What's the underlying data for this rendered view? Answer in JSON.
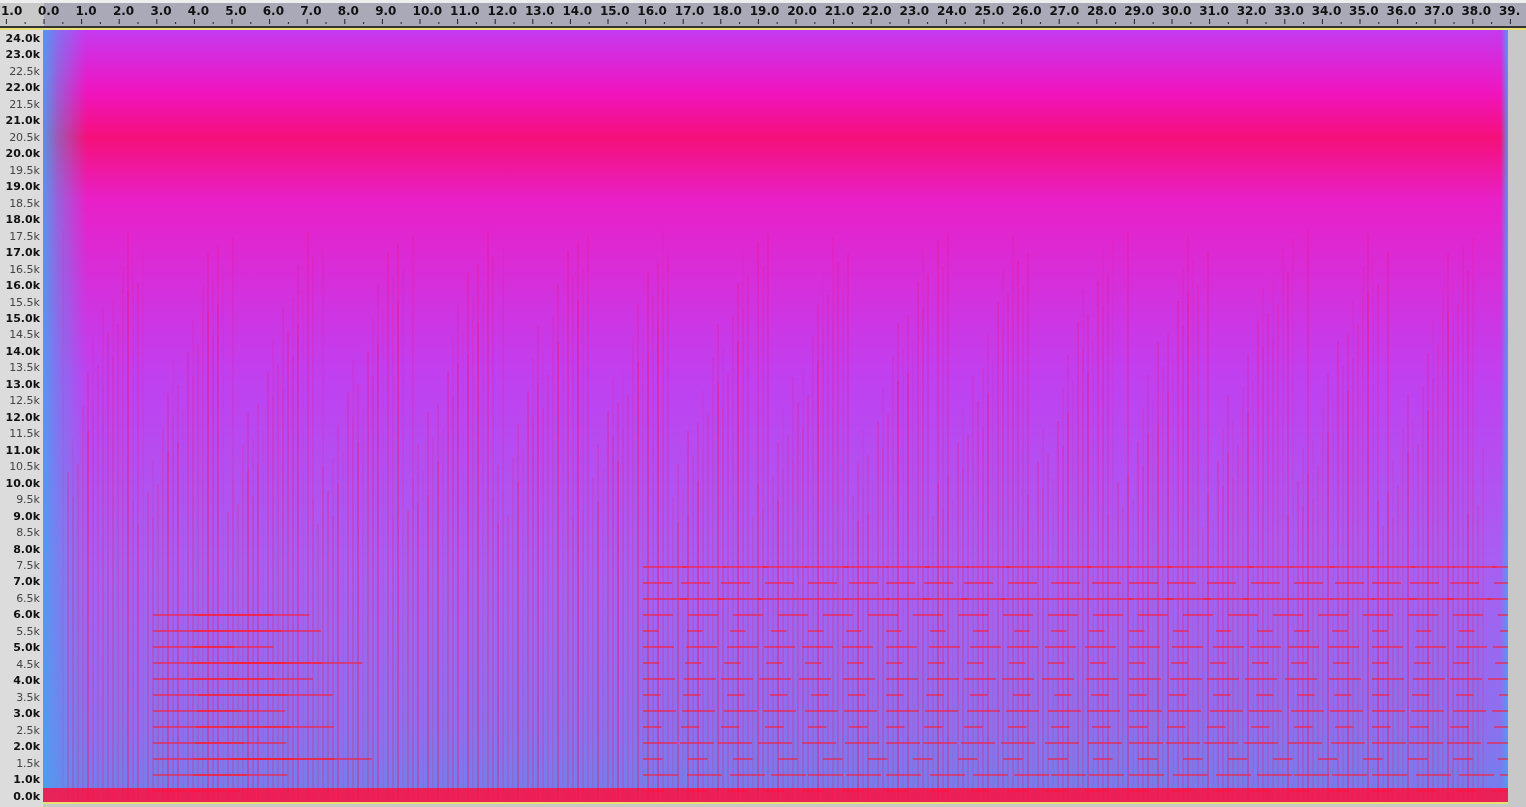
{
  "time_ruler": {
    "labels": [
      "1.0",
      "0.0",
      "1.0",
      "2.0",
      "3.0",
      "4.0",
      "5.0",
      "6.0",
      "7.0",
      "8.0",
      "9.0",
      "10.0",
      "11.0",
      "12.0",
      "13.0",
      "14.0",
      "15.0",
      "16.0",
      "17.0",
      "18.0",
      "19.0",
      "20.0",
      "21.0",
      "22.0",
      "23.0",
      "24.0",
      "25.0",
      "26.0",
      "27.0",
      "28.0",
      "29.0",
      "30.0",
      "31.0",
      "32.0",
      "33.0",
      "34.0",
      "35.0",
      "36.0",
      "37.0",
      "38.0",
      "39."
    ]
  },
  "frequency_ruler": {
    "labels": [
      {
        "text": "24.0k",
        "major": true
      },
      {
        "text": "23.0k",
        "major": true
      },
      {
        "text": "22.5k",
        "major": false
      },
      {
        "text": "22.0k",
        "major": true
      },
      {
        "text": "21.5k",
        "major": false
      },
      {
        "text": "21.0k",
        "major": true
      },
      {
        "text": "20.5k",
        "major": false
      },
      {
        "text": "20.0k",
        "major": true
      },
      {
        "text": "19.5k",
        "major": false
      },
      {
        "text": "19.0k",
        "major": true
      },
      {
        "text": "18.5k",
        "major": false
      },
      {
        "text": "18.0k",
        "major": true
      },
      {
        "text": "17.5k",
        "major": false
      },
      {
        "text": "17.0k",
        "major": true
      },
      {
        "text": "16.5k",
        "major": false
      },
      {
        "text": "16.0k",
        "major": true
      },
      {
        "text": "15.5k",
        "major": false
      },
      {
        "text": "15.0k",
        "major": true
      },
      {
        "text": "14.5k",
        "major": false
      },
      {
        "text": "14.0k",
        "major": true
      },
      {
        "text": "13.5k",
        "major": false
      },
      {
        "text": "13.0k",
        "major": true
      },
      {
        "text": "12.5k",
        "major": false
      },
      {
        "text": "12.0k",
        "major": true
      },
      {
        "text": "11.5k",
        "major": false
      },
      {
        "text": "11.0k",
        "major": true
      },
      {
        "text": "10.5k",
        "major": false
      },
      {
        "text": "10.0k",
        "major": true
      },
      {
        "text": "9.5k",
        "major": false
      },
      {
        "text": "9.0k",
        "major": true
      },
      {
        "text": "8.5k",
        "major": false
      },
      {
        "text": "8.0k",
        "major": true
      },
      {
        "text": "7.5k",
        "major": false
      },
      {
        "text": "7.0k",
        "major": true
      },
      {
        "text": "6.5k",
        "major": false
      },
      {
        "text": "6.0k",
        "major": true
      },
      {
        "text": "5.5k",
        "major": false
      },
      {
        "text": "5.0k",
        "major": true
      },
      {
        "text": "4.5k",
        "major": false
      },
      {
        "text": "4.0k",
        "major": true
      },
      {
        "text": "3.5k",
        "major": false
      },
      {
        "text": "3.0k",
        "major": true
      },
      {
        "text": "2.5k",
        "major": false
      },
      {
        "text": "2.0k",
        "major": true
      },
      {
        "text": "1.5k",
        "major": false
      },
      {
        "text": "1.0k",
        "major": true
      },
      {
        "text": "0.0k",
        "major": true
      }
    ]
  }
}
